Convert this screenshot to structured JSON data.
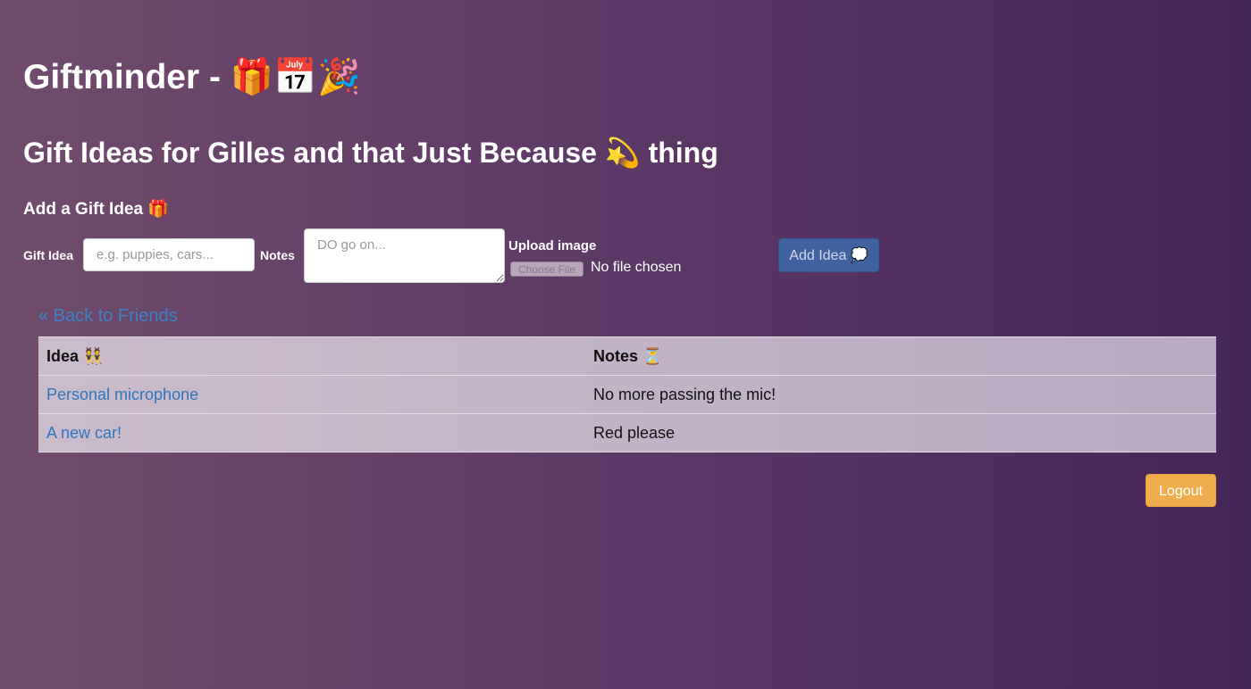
{
  "header": {
    "title": "Giftminder -",
    "title_icons": "🎁📅🎉"
  },
  "page": {
    "heading": "Gift Ideas for Gilles and that Just Because 💫 thing"
  },
  "form": {
    "heading": "Add a Gift Idea 🎁",
    "gift_idea_label": "Gift Idea",
    "gift_idea_placeholder": "e.g. puppies, cars...",
    "gift_idea_value": "",
    "notes_label": "Notes",
    "notes_placeholder": "DO go on...",
    "notes_value": "",
    "upload_label": "Upload image",
    "choose_file_label": "Choose File",
    "file_status": "No file chosen",
    "submit_label": "Add Idea 💭"
  },
  "navigation": {
    "back_label": "« Back to Friends"
  },
  "table": {
    "headers": [
      "Idea 👯",
      "Notes ⏳"
    ],
    "rows": [
      {
        "idea": "Personal microphone",
        "notes": "No more passing the mic!"
      },
      {
        "idea": "A new car!",
        "notes": "Red please"
      }
    ]
  },
  "footer": {
    "logout_label": "Logout"
  },
  "colors": {
    "background_start": "#714c6c",
    "background_end": "#452658",
    "primary_button": "#40639f",
    "logout_button": "#efad4e",
    "link": "#3c82c6"
  }
}
